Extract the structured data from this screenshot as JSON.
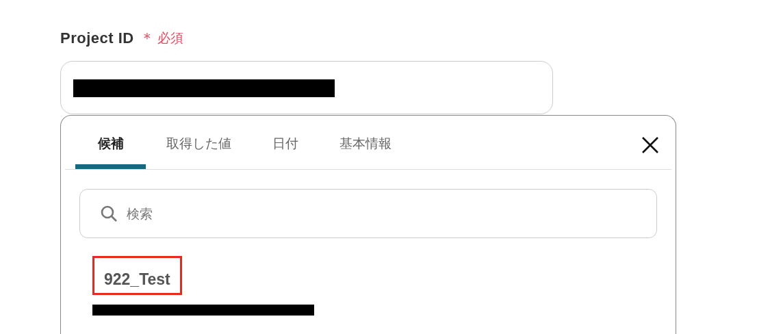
{
  "field": {
    "label": "Project ID",
    "required_mark": "＊",
    "required_text": "必須"
  },
  "popup": {
    "tabs": [
      {
        "label": "候補",
        "selected": true
      },
      {
        "label": "取得した値",
        "selected": false
      },
      {
        "label": "日付",
        "selected": false
      },
      {
        "label": "基本情報",
        "selected": false
      }
    ],
    "search": {
      "placeholder": "検索"
    },
    "items": [
      {
        "title": "922_Test",
        "highlighted": true
      }
    ]
  }
}
